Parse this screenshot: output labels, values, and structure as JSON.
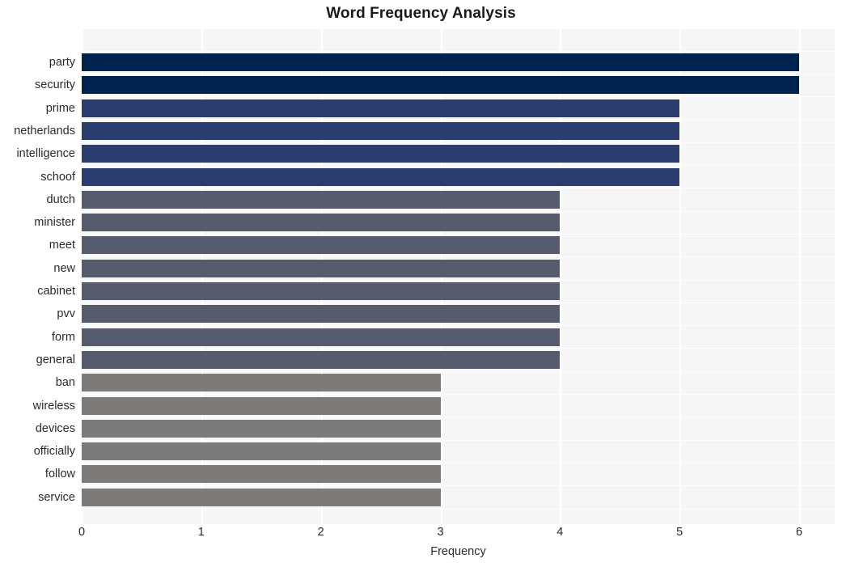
{
  "chart_data": {
    "type": "bar",
    "orientation": "horizontal",
    "title": "Word Frequency Analysis",
    "xlabel": "Frequency",
    "ylabel": "",
    "categories": [
      "party",
      "security",
      "prime",
      "netherlands",
      "intelligence",
      "schoof",
      "dutch",
      "minister",
      "meet",
      "new",
      "cabinet",
      "pvv",
      "form",
      "general",
      "ban",
      "wireless",
      "devices",
      "officially",
      "follow",
      "service"
    ],
    "values": [
      6,
      6,
      5,
      5,
      5,
      5,
      4,
      4,
      4,
      4,
      4,
      4,
      4,
      4,
      3,
      3,
      3,
      3,
      3,
      3
    ],
    "bar_colors": [
      "#00224e",
      "#00224e",
      "#2a3d6e",
      "#2a3d6e",
      "#2a3d6e",
      "#2a3d6e",
      "#565b6e",
      "#565b6e",
      "#565b6e",
      "#565b6e",
      "#565b6e",
      "#565b6e",
      "#565b6e",
      "#565b6e",
      "#7c7b79",
      "#7c7b79",
      "#7c7b79",
      "#7c7b79",
      "#7c7b79",
      "#7c7b79"
    ],
    "xlim": [
      0,
      6
    ],
    "xticks": [
      0,
      1,
      2,
      3,
      4,
      5,
      6
    ],
    "xtick_labels": [
      "0",
      "1",
      "2",
      "3",
      "4",
      "5",
      "6"
    ],
    "grid": true,
    "grid_color": "#ffffff",
    "plot_background": "#f6f6f7",
    "figure_background": "#ffffff",
    "legend": null,
    "title_color": "#1a1a1a",
    "tick_label_color": "#2b2b2b"
  }
}
